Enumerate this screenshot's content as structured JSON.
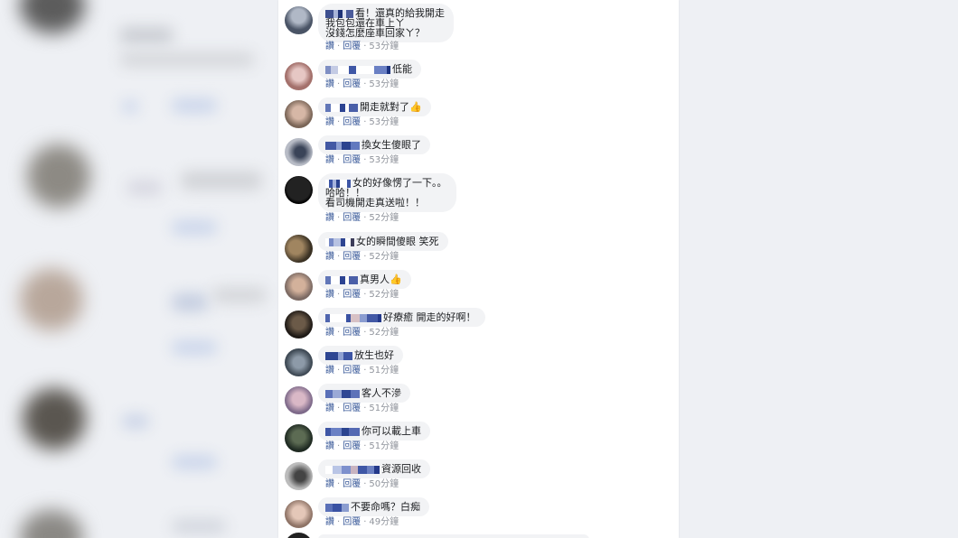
{
  "colors": {
    "link": "#385898",
    "meta": "#90949c",
    "bubble": "#f2f3f5",
    "text": "#1c1e21"
  },
  "comments": [
    {
      "text_lines": [
        "看！還真的給我開走",
        "我包包還在車上ㄚ",
        "沒錢怎麼座車回家ㄚ？"
      ],
      "like": "讚",
      "reply": "回覆",
      "time": "53分鐘"
    },
    {
      "text_lines": [
        "低能"
      ],
      "like": "讚",
      "reply": "回覆",
      "time": "53分鐘"
    },
    {
      "text_lines": [
        "開走就對了👍"
      ],
      "like": "讚",
      "reply": "回覆",
      "time": "53分鐘"
    },
    {
      "text_lines": [
        "換女生傻眼了"
      ],
      "like": "讚",
      "reply": "回覆",
      "time": "53分鐘"
    },
    {
      "text_lines": [
        "女的好像愣了一下。。",
        "哈哈！！",
        "看司機開走真送啦！！"
      ],
      "like": "讚",
      "reply": "回覆",
      "time": "52分鐘"
    },
    {
      "text_lines": [
        "女的瞬間傻眼 笑死"
      ],
      "like": "讚",
      "reply": "回覆",
      "time": "52分鐘"
    },
    {
      "text_lines": [
        "真男人👍"
      ],
      "like": "讚",
      "reply": "回覆",
      "time": "52分鐘"
    },
    {
      "text_lines": [
        "好療癒 開走的好啊！"
      ],
      "like": "讚",
      "reply": "回覆",
      "time": "52分鐘"
    },
    {
      "text_lines": [
        "放生也好"
      ],
      "like": "讚",
      "reply": "回覆",
      "time": "51分鐘"
    },
    {
      "text_lines": [
        "客人不滲"
      ],
      "like": "讚",
      "reply": "回覆",
      "time": "51分鐘"
    },
    {
      "text_lines": [
        "你可以載上車"
      ],
      "like": "讚",
      "reply": "回覆",
      "time": "51分鐘"
    },
    {
      "text_lines": [
        "資源回收"
      ],
      "like": "讚",
      "reply": "回覆",
      "time": "50分鐘"
    },
    {
      "text_lines": [
        "不要命嗎？白痴"
      ],
      "like": "讚",
      "reply": "回覆",
      "time": "49分鐘"
    }
  ]
}
